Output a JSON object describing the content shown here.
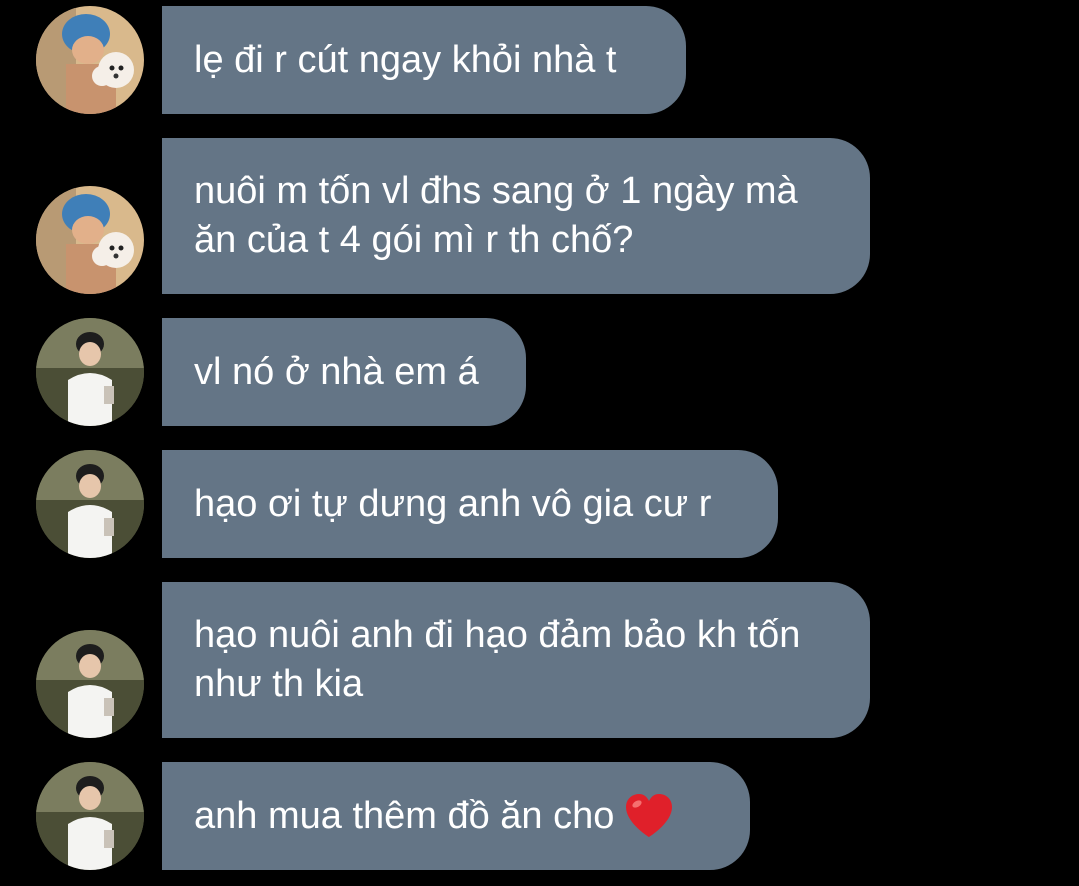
{
  "conversation": {
    "messages": [
      {
        "sender": "dog-owner",
        "avatar": "avatar-blue-hair-with-dog",
        "text": "lẹ đi r cút ngay khỏi nhà t"
      },
      {
        "sender": "dog-owner",
        "avatar": "avatar-blue-hair-with-dog",
        "text": "nuôi m tốn vl đhs sang ở 1 ngày mà ăn của t 4 gói mì r th chố?"
      },
      {
        "sender": "boy-with-drink",
        "avatar": "avatar-boy-with-drink",
        "text": "vl nó ở nhà em á"
      },
      {
        "sender": "boy-with-drink",
        "avatar": "avatar-boy-with-drink",
        "text": "hạo ơi tự dưng anh vô gia cư r"
      },
      {
        "sender": "boy-with-drink",
        "avatar": "avatar-boy-with-drink",
        "text": "hạo nuôi anh đi hạo đảm bảo kh tốn như th kia"
      },
      {
        "sender": "boy-with-drink",
        "avatar": "avatar-boy-with-drink",
        "text": "anh mua thêm đồ ăn cho",
        "emoji": "red-heart-icon"
      }
    ]
  },
  "colors": {
    "background": "#000000",
    "bubble": "#647586",
    "text": "#ffffff",
    "heart": "#e0202a"
  }
}
